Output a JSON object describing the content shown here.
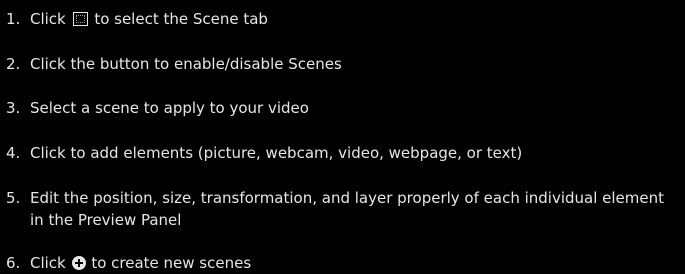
{
  "steps": [
    {
      "number": "1.",
      "before": "Click",
      "icon": "scene-tab-icon",
      "after": "to select the Scene tab"
    },
    {
      "number": "2.",
      "text": "Click the button to enable/disable Scenes"
    },
    {
      "number": "3.",
      "text": "Select a scene to apply to your video"
    },
    {
      "number": "4.",
      "text": "Click to add elements (picture, webcam, video, webpage, or text)"
    },
    {
      "number": "5.",
      "text": "Edit the position, size, transformation, and layer properly of each individual element in the Preview Panel"
    },
    {
      "number": "6.",
      "before": "Click",
      "icon": "add-circle-icon",
      "after": "to create new scenes"
    }
  ],
  "colors": {
    "background": "#000000",
    "text": "#e6e6e6"
  }
}
